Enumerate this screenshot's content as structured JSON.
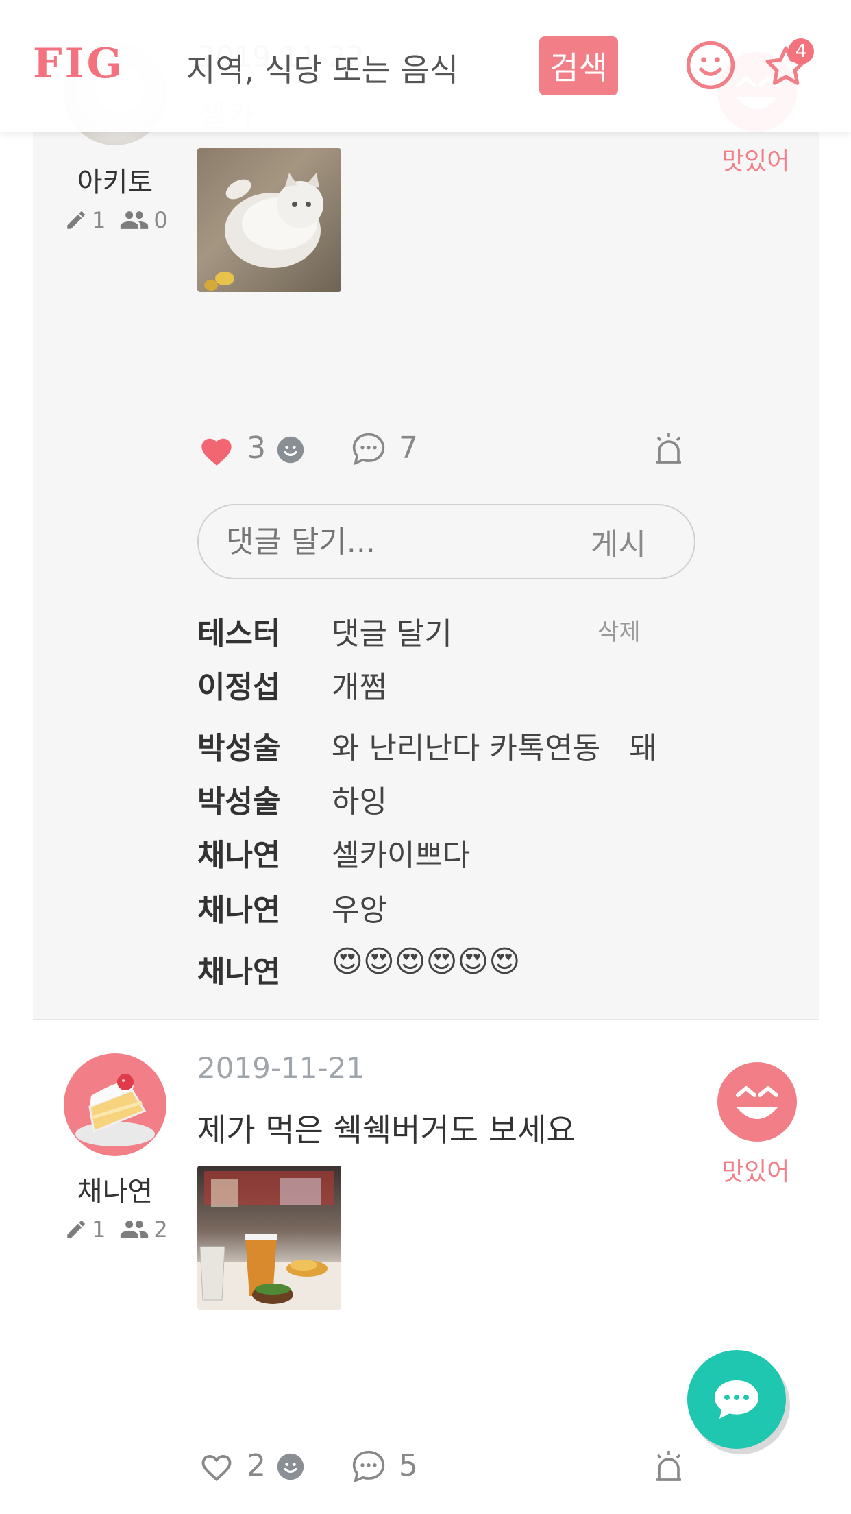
{
  "header": {
    "logo": "FIG",
    "search_placeholder": "지역, 식당 또는 음식",
    "search_button": "검색",
    "favorites_count": "4"
  },
  "colors": {
    "accent": "#f27f88",
    "fab": "#1fc7b0",
    "card_bg": "#f6f6f6"
  },
  "post1": {
    "date": "2019-11-22",
    "title": "셀카",
    "author": "아키토",
    "posts_count": "1",
    "followers_count": "0",
    "mood_label": "맛있어",
    "like_count": "3",
    "comment_count": "7",
    "comment_placeholder": "댓글 달기...",
    "post_button": "게시",
    "delete_label": "삭제",
    "comments": [
      {
        "author": "테스터",
        "text": "댓글 달기"
      },
      {
        "author": "이정섭",
        "text": "개쩜"
      },
      {
        "author": "박성술",
        "text": "와 난리난다 카톡연동   돼"
      },
      {
        "author": "박성술",
        "text": "하잉"
      },
      {
        "author": "채나연",
        "text": "셀카이쁘다"
      },
      {
        "author": "채나연",
        "text": "우앙"
      },
      {
        "author": "채나연",
        "text": "😍😍😍😍😍😍"
      }
    ]
  },
  "post2": {
    "date": "2019-11-21",
    "title": "제가 먹은 쉑쉑버거도 보세요",
    "author": "채나연",
    "posts_count": "1",
    "followers_count": "2",
    "mood_label": "맛있어",
    "like_count": "2",
    "comment_count": "5"
  },
  "icons": [
    "heart-icon",
    "smiley-icon",
    "chat-bubble-icon",
    "siren-icon",
    "pencil-icon",
    "people-icon",
    "star-icon",
    "laughing-face-icon"
  ]
}
